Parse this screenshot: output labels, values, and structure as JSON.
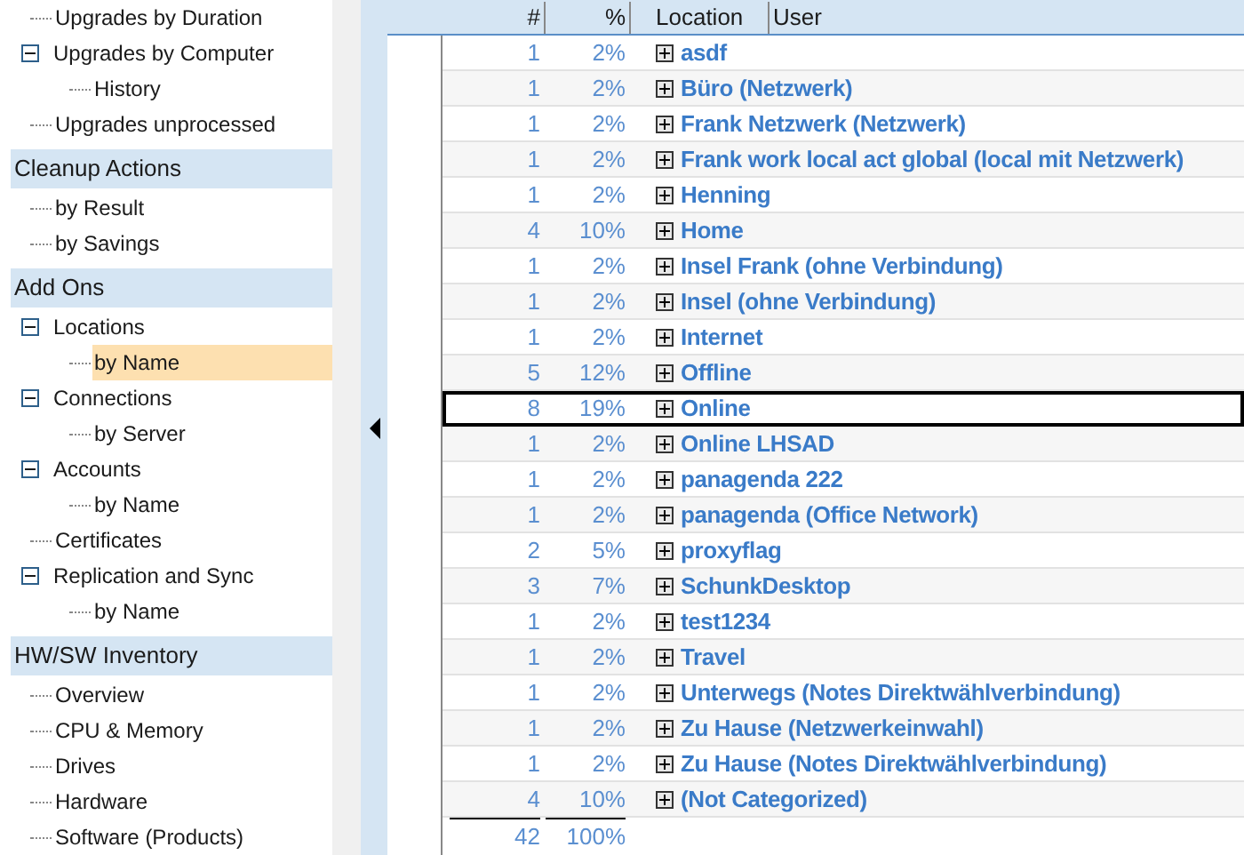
{
  "sidebar": {
    "sections": [
      {
        "items": [
          {
            "label": "Upgrades by Duration",
            "selected": false
          },
          {
            "label": "Upgrades by Computer",
            "expanded": true,
            "selected": false,
            "children": [
              {
                "label": "History",
                "selected": false
              }
            ]
          },
          {
            "label": "Upgrades unprocessed",
            "selected": false
          }
        ]
      },
      {
        "title": "Cleanup Actions",
        "items": [
          {
            "label": "by Result",
            "selected": false
          },
          {
            "label": "by Savings",
            "selected": false
          }
        ]
      },
      {
        "title": "Add Ons",
        "items": [
          {
            "label": "Locations",
            "expanded": true,
            "selected": false,
            "children": [
              {
                "label": "by Name",
                "selected": true
              }
            ]
          },
          {
            "label": "Connections",
            "expanded": true,
            "selected": false,
            "children": [
              {
                "label": "by Server",
                "selected": false
              }
            ]
          },
          {
            "label": "Accounts",
            "expanded": true,
            "selected": false,
            "children": [
              {
                "label": "by Name",
                "selected": false
              }
            ]
          },
          {
            "label": "Certificates",
            "selected": false
          },
          {
            "label": "Replication and Sync",
            "expanded": true,
            "selected": false,
            "children": [
              {
                "label": "by Name",
                "selected": false
              }
            ]
          }
        ]
      },
      {
        "title": "HW/SW Inventory",
        "items": [
          {
            "label": "Overview",
            "selected": false
          },
          {
            "label": "CPU & Memory",
            "selected": false
          },
          {
            "label": "Drives",
            "selected": false
          },
          {
            "label": "Hardware",
            "selected": false
          },
          {
            "label": "Software (Products)",
            "selected": false
          }
        ]
      }
    ]
  },
  "table": {
    "columns": [
      "#",
      "%",
      "Location",
      "User"
    ],
    "rows": [
      {
        "count": "1",
        "percent": "2%",
        "location": "asdf",
        "focused": false
      },
      {
        "count": "1",
        "percent": "2%",
        "location": "Büro (Netzwerk)",
        "focused": false
      },
      {
        "count": "1",
        "percent": "2%",
        "location": "Frank Netzwerk (Netzwerk)",
        "focused": false
      },
      {
        "count": "1",
        "percent": "2%",
        "location": "Frank work local act global (local mit Netzwerk)",
        "focused": false
      },
      {
        "count": "1",
        "percent": "2%",
        "location": "Henning",
        "focused": false
      },
      {
        "count": "4",
        "percent": "10%",
        "location": "Home",
        "focused": false
      },
      {
        "count": "1",
        "percent": "2%",
        "location": "Insel Frank (ohne Verbindung)",
        "focused": false
      },
      {
        "count": "1",
        "percent": "2%",
        "location": "Insel (ohne Verbindung)",
        "focused": false
      },
      {
        "count": "1",
        "percent": "2%",
        "location": "Internet",
        "focused": false
      },
      {
        "count": "5",
        "percent": "12%",
        "location": "Offline",
        "focused": false
      },
      {
        "count": "8",
        "percent": "19%",
        "location": "Online",
        "focused": true
      },
      {
        "count": "1",
        "percent": "2%",
        "location": "Online LHSAD",
        "focused": false
      },
      {
        "count": "1",
        "percent": "2%",
        "location": "panagenda 222",
        "focused": false
      },
      {
        "count": "1",
        "percent": "2%",
        "location": "panagenda (Office Network)",
        "focused": false
      },
      {
        "count": "2",
        "percent": "5%",
        "location": "proxyflag",
        "focused": false
      },
      {
        "count": "3",
        "percent": "7%",
        "location": "SchunkDesktop",
        "focused": false
      },
      {
        "count": "1",
        "percent": "2%",
        "location": "test1234",
        "focused": false
      },
      {
        "count": "1",
        "percent": "2%",
        "location": "Travel",
        "focused": false
      },
      {
        "count": "1",
        "percent": "2%",
        "location": "Unterwegs (Notes Direktwählverbindung)",
        "focused": false
      },
      {
        "count": "1",
        "percent": "2%",
        "location": "Zu Hause (Netzwerkeinwahl)",
        "focused": false
      },
      {
        "count": "1",
        "percent": "2%",
        "location": "Zu Hause (Notes Direktwählverbindung)",
        "focused": false
      },
      {
        "count": "4",
        "percent": "10%",
        "location": "(Not Categorized)",
        "focused": false
      }
    ],
    "total": {
      "count": "42",
      "percent": "100%"
    }
  }
}
